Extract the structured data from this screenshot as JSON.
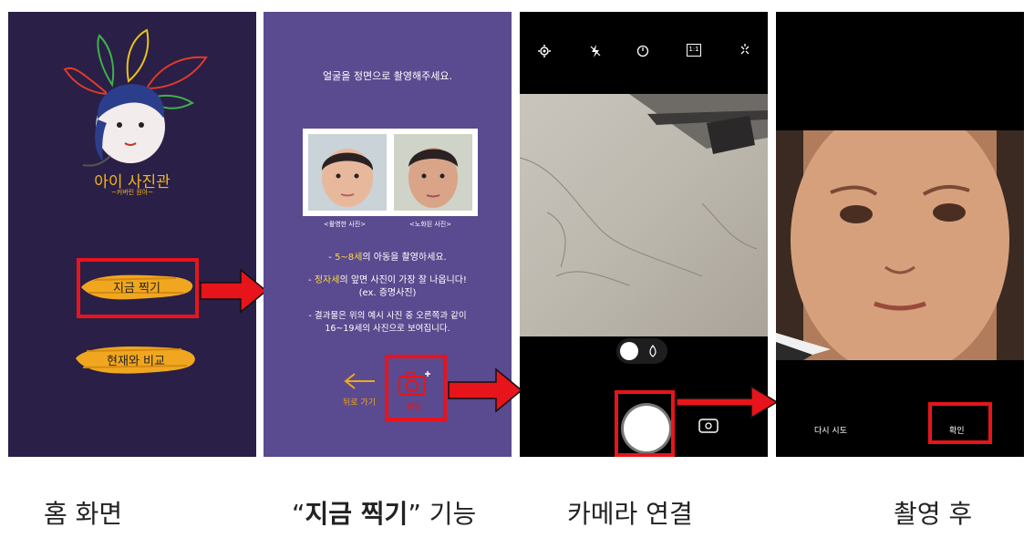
{
  "screen1": {
    "app_title": "아이 사진관",
    "app_subtitle": "~커버린 원아~",
    "btn_take_now": "지금 찍기",
    "btn_compare": "현재와 비교"
  },
  "screen2": {
    "heading": "얼굴을 정면으로 촬영해주세요.",
    "caption_left": "<촬영한 사진>",
    "caption_right": "<노화된 사진>",
    "tip1_prefix": "- ",
    "tip1_highlight": "5~8세",
    "tip1_suffix": "의 아동을 촬영하세요.",
    "tip2_prefix": "- ",
    "tip2_highlight": "정자세",
    "tip2_suffix": "의 앞면 사진이 가장 잘 나옵니다!",
    "tip2_sub": "(ex. 증명사진)",
    "tip3_line1": "- 결과물은 위의 예시 사진 중 오른쪽과 같이",
    "tip3_line2": "16~19세의 사진으로 보여집니다.",
    "btn_back": "뒤로 가기",
    "btn_shoot": "촬영"
  },
  "screen3": {
    "top_icons": [
      "settings-icon",
      "flash-off-icon",
      "timer-off-icon",
      "ratio-1-1-icon",
      "sparkle-icon"
    ],
    "ratio_label": "1:1"
  },
  "screen4": {
    "btn_retry": "다시 시도",
    "btn_confirm": "확인"
  },
  "captions": {
    "c1": "홈 화면",
    "c2_open": "“",
    "c2_bold": "지금 찍기",
    "c2_close": "” 기능",
    "c3": "카메라 연결",
    "c4": "촬영 후"
  },
  "colors": {
    "highlight_red": "#e8141b",
    "title_gold": "#f2b51c",
    "tip_yellow": "#ffd84a"
  }
}
